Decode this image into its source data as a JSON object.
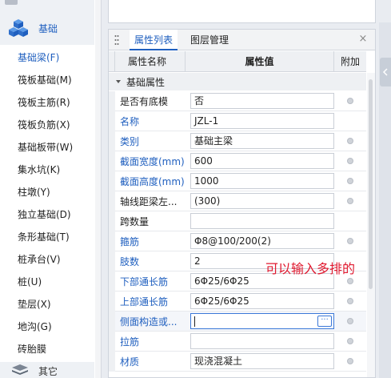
{
  "left_panel": {
    "group_label": "基础",
    "items": [
      {
        "label": "基础梁(F)"
      },
      {
        "label": "筏板基础(M)"
      },
      {
        "label": "筏板主筋(R)"
      },
      {
        "label": "筏板负筋(X)"
      },
      {
        "label": "基础板带(W)"
      },
      {
        "label": "集水坑(K)"
      },
      {
        "label": "柱墩(Y)"
      },
      {
        "label": "独立基础(D)"
      },
      {
        "label": "条形基础(T)"
      },
      {
        "label": "桩承台(V)"
      },
      {
        "label": "桩(U)"
      },
      {
        "label": "垫层(X)"
      },
      {
        "label": "地沟(G)"
      },
      {
        "label": "砖胎膜"
      }
    ],
    "bottom_group_label": "其它"
  },
  "properties_panel": {
    "tabs": [
      {
        "label": "属性列表"
      },
      {
        "label": "图层管理"
      }
    ],
    "close_label": "×",
    "columns": {
      "name": "属性名称",
      "value": "属性值",
      "add": "附加"
    },
    "section": "基础属性",
    "rows": [
      {
        "name": "是否有底模",
        "value": "否"
      },
      {
        "name": "名称",
        "value": "JZL-1"
      },
      {
        "name": "类别",
        "value": "基础主梁"
      },
      {
        "name": "截面宽度(mm)",
        "value": "600"
      },
      {
        "name": "截面高度(mm)",
        "value": "1000"
      },
      {
        "name": "轴线距梁左...",
        "value": "(300)"
      },
      {
        "name": "跨数量",
        "value": ""
      },
      {
        "name": "箍筋",
        "value": "Φ8@100/200(2)"
      },
      {
        "name": "肢数",
        "value": "2"
      },
      {
        "name": "下部通长筋",
        "value": "6Φ25/6Φ25"
      },
      {
        "name": "上部通长筋",
        "value": "6Φ25/6Φ25"
      },
      {
        "name": "侧面构造或...",
        "value": "",
        "ellipsis": "···"
      },
      {
        "name": "拉筋",
        "value": ""
      },
      {
        "name": "材质",
        "value": "现浇混凝土"
      }
    ]
  },
  "annotation": "可以输入多排的",
  "colors": {
    "accent": "#1f5fbf",
    "annotation": "#e0192f",
    "focus_border": "#3b78d8"
  },
  "icons": {
    "group": "stacked-cubes-icon",
    "bottom_group": "layers-icon",
    "grip": "grip-dots-icon",
    "close": "close-icon",
    "section": "triangle-down-icon",
    "add_indicator": "circle-dot-icon",
    "ellipsis": "ellipsis-button-icon",
    "collapse": "chevron-left-icon"
  }
}
